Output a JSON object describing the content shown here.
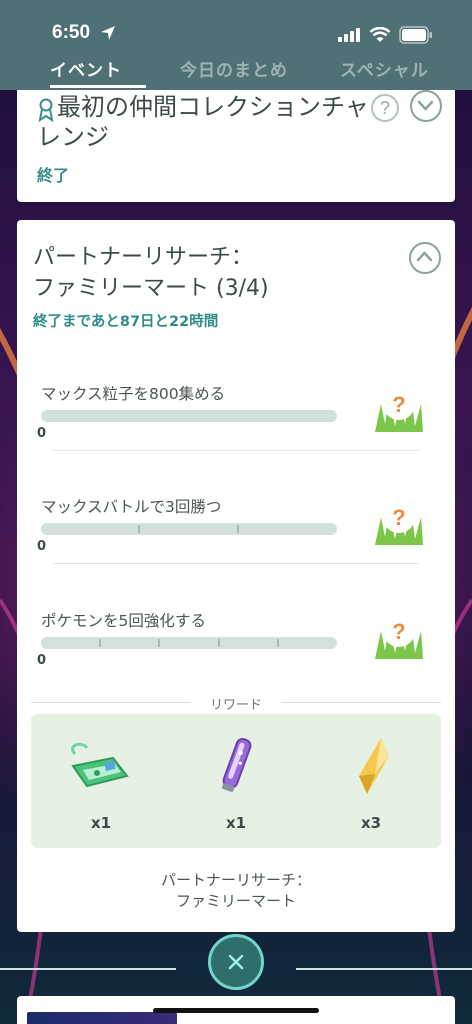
{
  "status_bar": {
    "time": "6:50"
  },
  "tabs": [
    {
      "label": "イベント",
      "active": true
    },
    {
      "label": "今日のまとめ",
      "active": false
    },
    {
      "label": "スペシャル",
      "active": false
    }
  ],
  "card1": {
    "title": "最初の仲間コレクションチャレンジ",
    "status": "終了"
  },
  "card2": {
    "title_line1": "パートナーリサーチ：",
    "title_line2": "ファミリーマート (3/4)",
    "time_remaining": "終了まであと87日と22時間",
    "tasks": [
      {
        "label": "マックス粒子を800集める",
        "value": "0",
        "progress": 0
      },
      {
        "label": "マックスバトルで3回勝つ",
        "value": "0",
        "progress": 0
      },
      {
        "label": "ポケモンを5回強化する",
        "value": "0",
        "progress": 0
      }
    ],
    "rewards_label": "リワード",
    "rewards": [
      {
        "icon": "ticket-icon",
        "qty": "x1"
      },
      {
        "icon": "max-particle-stick-icon",
        "qty": "x1"
      },
      {
        "icon": "crystal-shard-icon",
        "qty": "x3"
      }
    ],
    "footer_line1": "パートナーリサーチ：",
    "footer_line2": "ファミリーマート"
  },
  "colors": {
    "header_bg": "#4f7176",
    "accent_teal": "#2f8c88",
    "reward_bg": "#e6f1e4",
    "progress_track": "#d3e0db"
  }
}
